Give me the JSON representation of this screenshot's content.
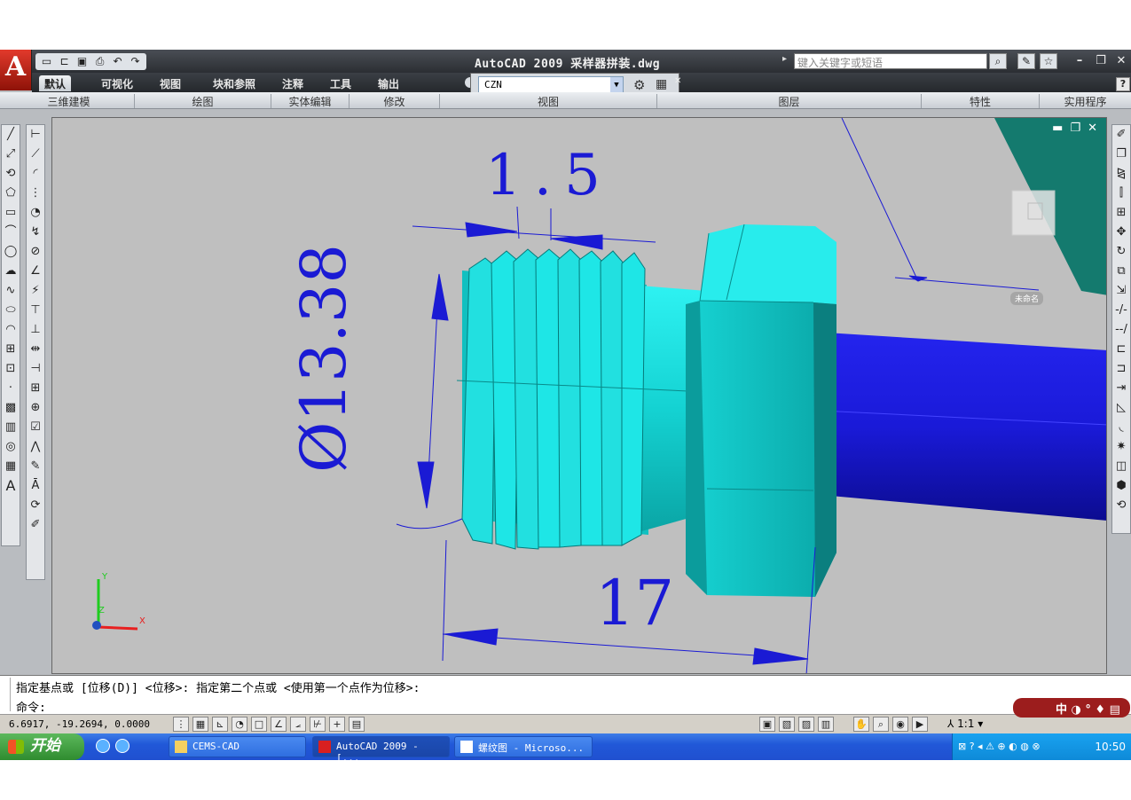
{
  "app": {
    "logo_letter": "A",
    "window_title": "AutoCAD 2009 采样器拼装.dwg",
    "help_search_placeholder": "键入关键字或短语",
    "help_label": "?"
  },
  "ribbon": {
    "tabs": [
      "默认",
      "可视化",
      "视图",
      "块和参照",
      "注释",
      "工具",
      "输出"
    ],
    "active_tab": "默认",
    "workspace": "CZN",
    "panels": [
      "三维建模",
      "绘图",
      "实体编辑",
      "修改",
      "视图",
      "图层",
      "特性",
      "实用程序"
    ]
  },
  "viewport": {
    "model_label": "未命名",
    "dimensions": {
      "pitch": "1.5",
      "diameter": "Ø13.38",
      "length": "17"
    },
    "ucs": {
      "x": "X",
      "y": "Y",
      "z": "Z"
    }
  },
  "command_line": {
    "history": "指定基点或 [位移(D)] <位移>:  指定第二个点或 <使用第一个点作为位移>:",
    "prompt": "命令:"
  },
  "status": {
    "coords": "6.6917,  -19.2694, 0.0000",
    "scale": "1:1"
  },
  "taskbar": {
    "start_label": "开始",
    "tasks": [
      "CEMS-CAD",
      "AutoCAD 2009 - [...",
      "螺纹图 - Microso..."
    ],
    "clock": "10:50",
    "ime": "中"
  },
  "colors": {
    "dimension": "#1a1ad4",
    "bolt_body": "#16dede",
    "shaft": "#1414d8",
    "viewport_bg": "#bfbfbf"
  }
}
